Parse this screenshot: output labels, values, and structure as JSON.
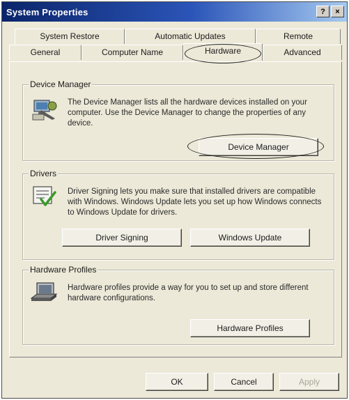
{
  "window": {
    "title": "System Properties",
    "help_button": "?",
    "close_button": "×"
  },
  "tabs": {
    "row1": [
      "System Restore",
      "Automatic Updates",
      "Remote"
    ],
    "row2": [
      "General",
      "Computer Name",
      "Hardware",
      "Advanced"
    ],
    "active": "Hardware"
  },
  "device_manager": {
    "title": "Device Manager",
    "description": "The Device Manager lists all the hardware devices installed on your computer. Use the Device Manager to change the properties of any device.",
    "button": "Device Manager",
    "icon": "device-manager-icon"
  },
  "drivers": {
    "title": "Drivers",
    "description": "Driver Signing lets you make sure that installed drivers are compatible with Windows. Windows Update lets you set up how Windows connects to Windows Update for drivers.",
    "signing_button": "Driver Signing",
    "update_button": "Windows Update",
    "icon": "driver-signing-icon"
  },
  "hardware_profiles": {
    "title": "Hardware Profiles",
    "description": "Hardware profiles provide a way for you to set up and store different hardware configurations.",
    "button": "Hardware Profiles",
    "icon": "hardware-profiles-icon"
  },
  "footer": {
    "ok": "OK",
    "cancel": "Cancel",
    "apply": "Apply"
  }
}
